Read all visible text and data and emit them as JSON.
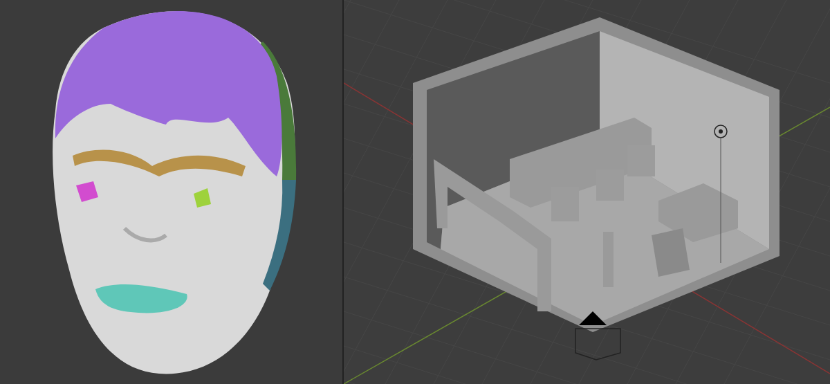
{
  "viewports": [
    {
      "kind": "sculpt"
    },
    {
      "kind": "scene"
    }
  ]
}
